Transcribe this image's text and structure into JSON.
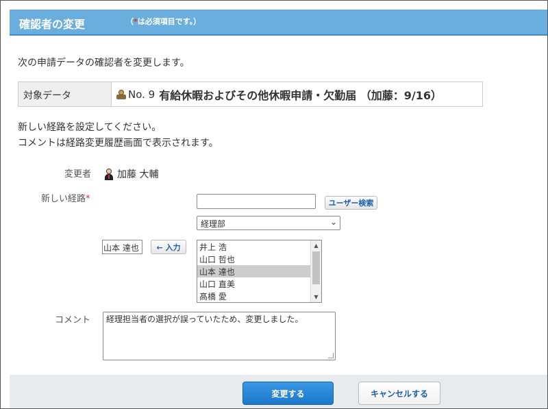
{
  "header": {
    "title": "確認者の変更",
    "note_open": "（",
    "note_star": "*",
    "note_rest": "は必須項目です。）"
  },
  "intro": "次の申請データの確認者を変更します。",
  "target": {
    "label": "対象データ",
    "icon": "workflow-app-icon",
    "number": "No. 9",
    "title": "有給休暇およびその他休暇申請・欠勤届 （加藤：9/16）"
  },
  "instructions": {
    "line1": "新しい経路を設定してください。",
    "line2": "コメントは経路変更履歴画面で表示されます。"
  },
  "changer": {
    "label": "変更者",
    "icon": "user-icon",
    "name": "加藤 大輔"
  },
  "route": {
    "label": "新しい経路",
    "required_mark": "*",
    "search_value": "",
    "search_button": "ユーザー検索",
    "department": "経理部",
    "selected_user": "山本 達也",
    "add_button": "← 入力",
    "users": [
      "井上 浩",
      "山口 哲也",
      "山本 達也",
      "山口 直美",
      "髙橋 愛"
    ],
    "selected_index": 2
  },
  "comment": {
    "label": "コメント",
    "value": "経理担当者の選択が誤っていたため、変更しました。"
  },
  "buttons": {
    "submit": "変更する",
    "cancel": "キャンセルする"
  }
}
